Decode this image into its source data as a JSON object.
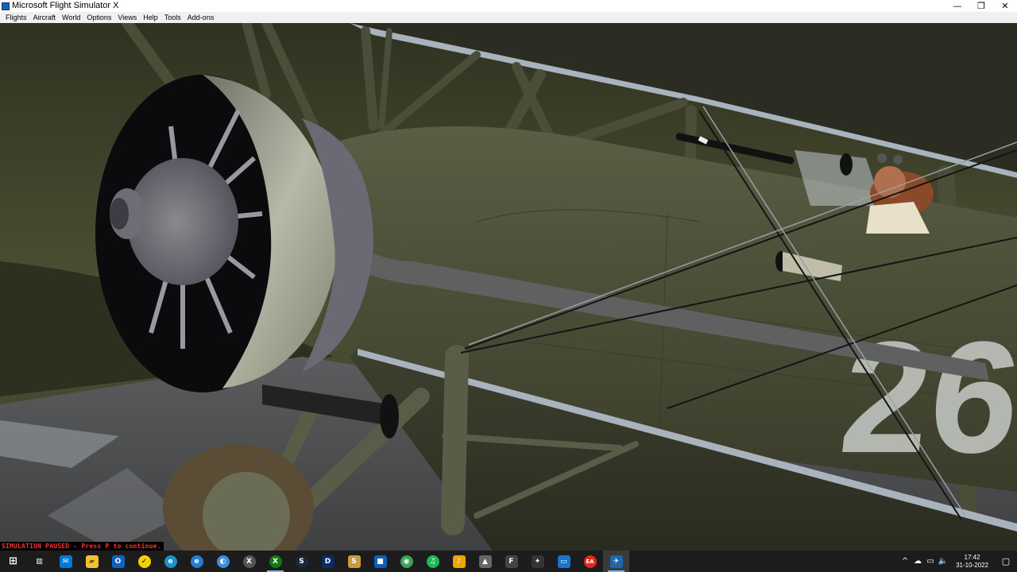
{
  "window": {
    "title": "Microsoft Flight Simulator X",
    "minimize": "—",
    "maximize": "❐",
    "close": "✕"
  },
  "menu": [
    "Flights",
    "Aircraft",
    "World",
    "Options",
    "Views",
    "Help",
    "Tools",
    "Add-ons"
  ],
  "status": {
    "paused_text": "SIMULATION PAUSED - Press P to continue."
  },
  "aircraft": {
    "fuselage_number": "26"
  },
  "taskbar": {
    "apps": [
      {
        "name": "start-icon",
        "glyph": "⊞",
        "color": "#1c1c1c"
      },
      {
        "name": "task-view-icon",
        "glyph": "▥",
        "color": "#1c1c1c"
      },
      {
        "name": "mail-icon",
        "glyph": "✉",
        "color": "#0078d4"
      },
      {
        "name": "file-explorer-icon",
        "glyph": "▰",
        "color": "#f2c12e"
      },
      {
        "name": "outlook-icon",
        "glyph": "O",
        "color": "#0a64c2"
      },
      {
        "name": "norton-icon",
        "glyph": "✓",
        "color": "#f5d000"
      },
      {
        "name": "edge-icon",
        "glyph": "e",
        "color": "#1e90c8"
      },
      {
        "name": "edge-alt-icon",
        "glyph": "e",
        "color": "#2a7ad1"
      },
      {
        "name": "browser-icon",
        "glyph": "◐",
        "color": "#3b8fd8"
      },
      {
        "name": "xbox-icon",
        "glyph": "X",
        "color": "#555555"
      },
      {
        "name": "xbox-app-icon",
        "glyph": "X",
        "color": "#107c10"
      },
      {
        "name": "steam-icon",
        "glyph": "S",
        "color": "#1b2838"
      },
      {
        "name": "dolby-icon",
        "glyph": "D",
        "color": "#0b2a6b"
      },
      {
        "name": "spad-icon",
        "glyph": "S",
        "color": "#c89b3c"
      },
      {
        "name": "blue-app-icon",
        "glyph": "■",
        "color": "#0a5fbf"
      },
      {
        "name": "chrome-app-icon",
        "glyph": "◉",
        "color": "#3aa35b"
      },
      {
        "name": "spotify-icon",
        "glyph": "♫",
        "color": "#1db954"
      },
      {
        "name": "music-icon",
        "glyph": "♪",
        "color": "#f0a400"
      },
      {
        "name": "airplane-app-icon",
        "glyph": "▲",
        "color": "#666666"
      },
      {
        "name": "fsx-tool-icon",
        "glyph": "F",
        "color": "#444444"
      },
      {
        "name": "joystick-icon",
        "glyph": "✦",
        "color": "#333333"
      },
      {
        "name": "monitor-icon",
        "glyph": "▭",
        "color": "#1a73c9"
      },
      {
        "name": "ea-icon",
        "glyph": "EA",
        "color": "#e0281b"
      },
      {
        "name": "flight-sim-icon",
        "glyph": "✈",
        "color": "#2266aa"
      }
    ],
    "tray": {
      "chevron": "^",
      "cloud": "☁",
      "network": "▭",
      "volume": "🔈",
      "time": "17:42",
      "date": "31-10-2022",
      "notifications": "▢"
    }
  }
}
